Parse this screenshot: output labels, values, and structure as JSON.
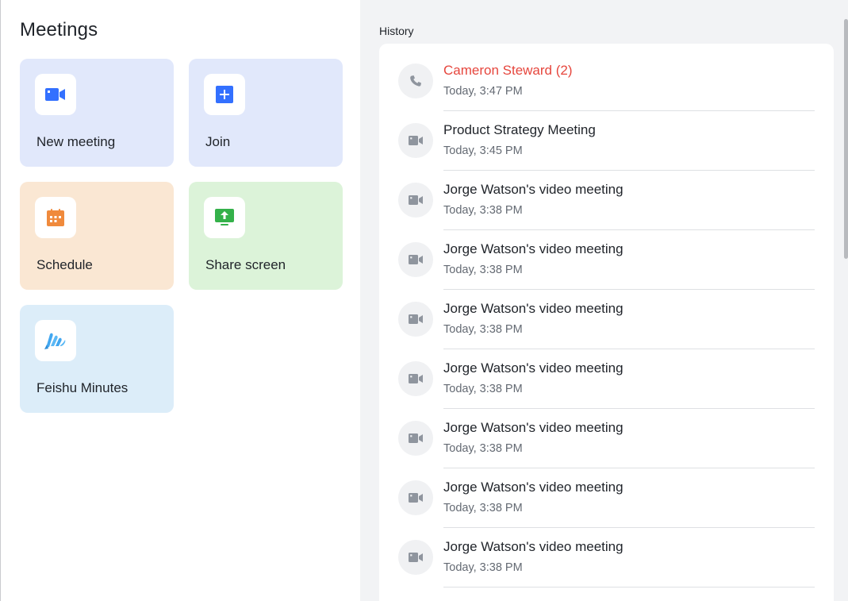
{
  "page": {
    "title": "Meetings"
  },
  "tiles": [
    {
      "id": "new",
      "label": "New meeting",
      "icon": "video-camera-icon",
      "bg": "#e1e8fb",
      "icon_color": "#3370ff"
    },
    {
      "id": "join",
      "label": "Join",
      "icon": "plus-square-icon",
      "bg": "#e1e8fb",
      "icon_color": "#3370ff"
    },
    {
      "id": "schedule",
      "label": "Schedule",
      "icon": "calendar-icon",
      "bg": "#fae7d3",
      "icon_color": "#f08a3c"
    },
    {
      "id": "share",
      "label": "Share screen",
      "icon": "share-screen-icon",
      "bg": "#dcf3d9",
      "icon_color": "#34b14a"
    },
    {
      "id": "minutes",
      "label": "Feishu Minutes",
      "icon": "minutes-logo-icon",
      "bg": "#dcedf9",
      "icon_color": "#42a7f0"
    }
  ],
  "history": {
    "title": "History",
    "items": [
      {
        "title": "Cameron Steward (2)",
        "time": "Today, 3:47 PM",
        "type": "call",
        "icon": "phone-icon",
        "missed": true
      },
      {
        "title": "Product Strategy Meeting",
        "time": "Today, 3:45 PM",
        "type": "video",
        "icon": "video-icon",
        "missed": false
      },
      {
        "title": "Jorge Watson's video meeting",
        "time": "Today, 3:38 PM",
        "type": "video",
        "icon": "video-icon",
        "missed": false
      },
      {
        "title": "Jorge Watson's video meeting",
        "time": "Today, 3:38 PM",
        "type": "video",
        "icon": "video-icon",
        "missed": false
      },
      {
        "title": "Jorge Watson's video meeting",
        "time": "Today, 3:38 PM",
        "type": "video",
        "icon": "video-icon",
        "missed": false
      },
      {
        "title": "Jorge Watson's video meeting",
        "time": "Today, 3:38 PM",
        "type": "video",
        "icon": "video-icon",
        "missed": false
      },
      {
        "title": "Jorge Watson's video meeting",
        "time": "Today, 3:38 PM",
        "type": "video",
        "icon": "video-icon",
        "missed": false
      },
      {
        "title": "Jorge Watson's video meeting",
        "time": "Today, 3:38 PM",
        "type": "video",
        "icon": "video-icon",
        "missed": false
      },
      {
        "title": "Jorge Watson's video meeting",
        "time": "Today, 3:38 PM",
        "type": "video",
        "icon": "video-icon",
        "missed": false
      }
    ]
  },
  "colors": {
    "missed": "#e6463d",
    "secondary_text": "#646a73",
    "history_icon": "#8f959e"
  }
}
